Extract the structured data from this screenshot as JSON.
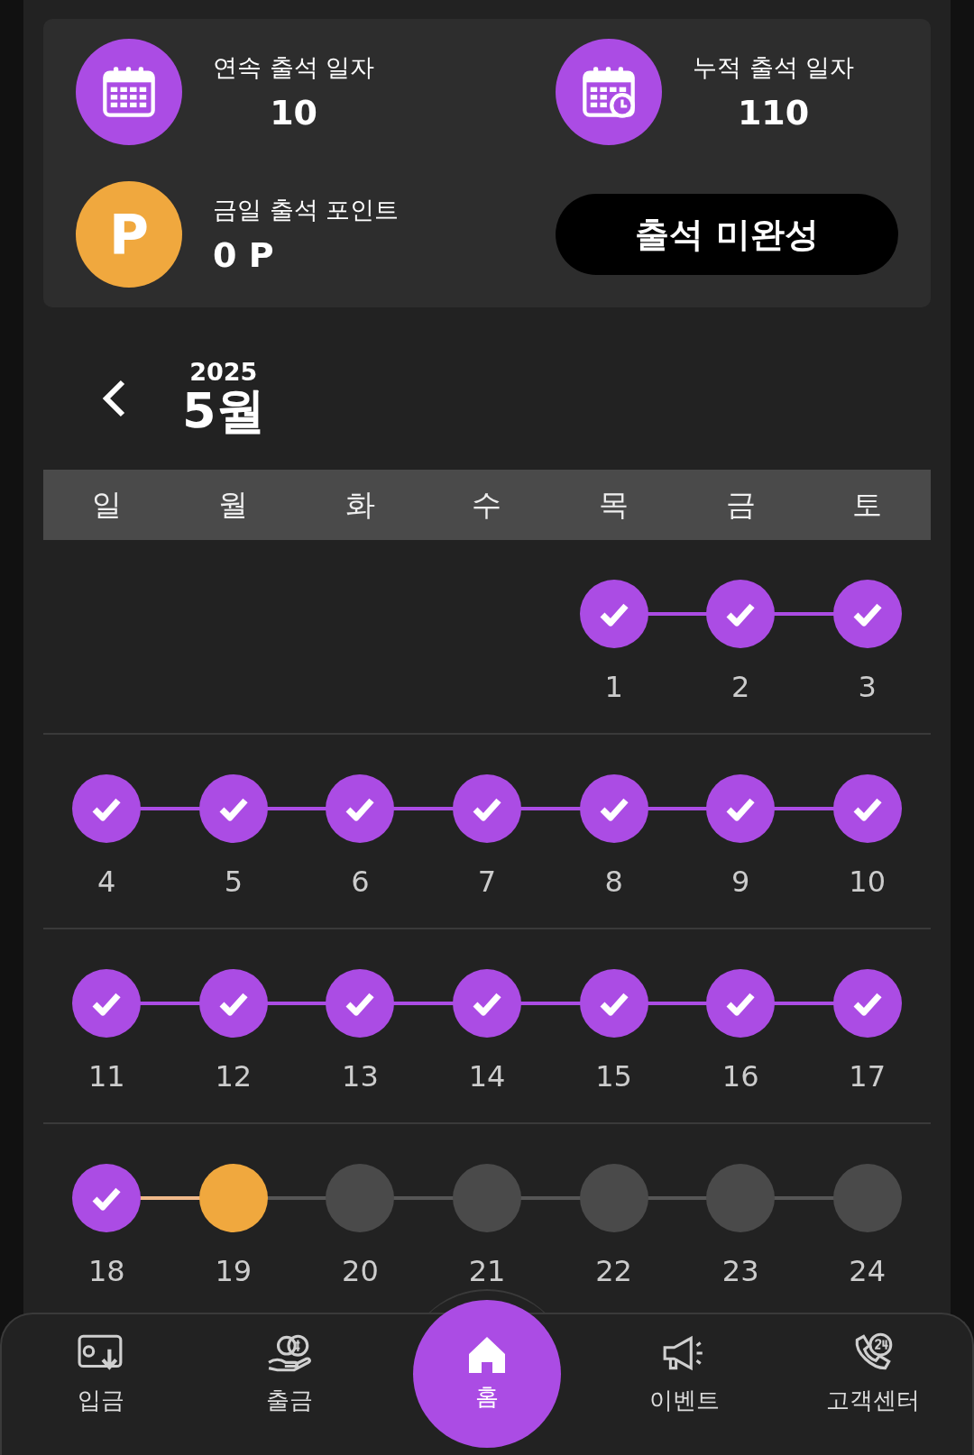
{
  "stats": [
    {
      "kind": "streak",
      "label": "연속 출석 일자",
      "value": "10"
    },
    {
      "kind": "total",
      "label": "누적 출석 일자",
      "value": "110"
    }
  ],
  "points": {
    "icon_text": "P",
    "label": "금일 출석 포인트",
    "value": "0 P"
  },
  "attend_button": {
    "label": "출석 미완성"
  },
  "month_header": {
    "year": "2025",
    "month": "5월"
  },
  "weekdays": [
    "일",
    "월",
    "화",
    "수",
    "목",
    "금",
    "토"
  ],
  "weeks": [
    [
      {
        "kind": "blank"
      },
      {
        "kind": "blank"
      },
      {
        "kind": "blank"
      },
      {
        "kind": "blank"
      },
      {
        "kind": "done",
        "day": "1"
      },
      {
        "kind": "done",
        "day": "2"
      },
      {
        "kind": "done",
        "day": "3"
      }
    ],
    [
      {
        "kind": "done",
        "day": "4"
      },
      {
        "kind": "done",
        "day": "5"
      },
      {
        "kind": "done",
        "day": "6"
      },
      {
        "kind": "done",
        "day": "7"
      },
      {
        "kind": "done",
        "day": "8"
      },
      {
        "kind": "done",
        "day": "9"
      },
      {
        "kind": "done",
        "day": "10"
      }
    ],
    [
      {
        "kind": "done",
        "day": "11"
      },
      {
        "kind": "done",
        "day": "12"
      },
      {
        "kind": "done",
        "day": "13"
      },
      {
        "kind": "done",
        "day": "14"
      },
      {
        "kind": "done",
        "day": "15"
      },
      {
        "kind": "done",
        "day": "16"
      },
      {
        "kind": "done",
        "day": "17"
      }
    ],
    [
      {
        "kind": "done",
        "day": "18"
      },
      {
        "kind": "today",
        "day": "19"
      },
      {
        "kind": "future",
        "day": "20"
      },
      {
        "kind": "future",
        "day": "21"
      },
      {
        "kind": "future",
        "day": "22"
      },
      {
        "kind": "future",
        "day": "23"
      },
      {
        "kind": "future",
        "day": "24"
      }
    ]
  ],
  "nav": [
    {
      "kind": "deposit",
      "label": "입금",
      "selected": false
    },
    {
      "kind": "withdraw",
      "label": "출금",
      "selected": false
    },
    {
      "kind": "home",
      "label": "홈",
      "selected": true
    },
    {
      "kind": "event",
      "label": "이벤트",
      "selected": false
    },
    {
      "kind": "support",
      "label": "고객센터",
      "selected": false
    }
  ]
}
